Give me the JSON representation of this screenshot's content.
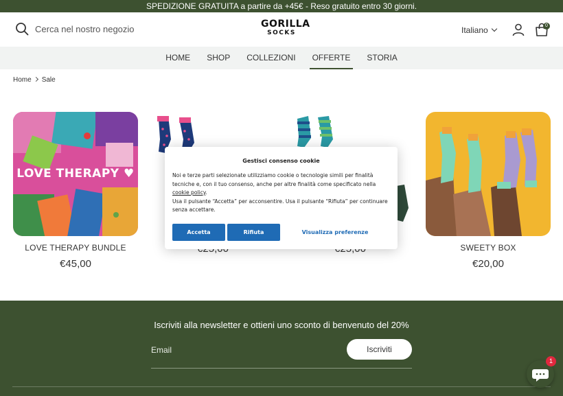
{
  "announcement": "SPEDIZIONE GRATUITA a partire da +45€ - Reso gratuito entro 30 giorni.",
  "header": {
    "search_placeholder": "Cerca nel nostro negozio",
    "logo_line1": "GORILLA",
    "logo_line2": "SOCKS",
    "language": "Italiano",
    "cart_count": "0"
  },
  "nav": [
    "HOME",
    "SHOP",
    "COLLEZIONI",
    "OFFERTE",
    "STORIA"
  ],
  "nav_active": "OFFERTE",
  "breadcrumb": {
    "home": "Home",
    "current": "Sale"
  },
  "products": [
    {
      "title": "LOVE THERAPY BUNDLE",
      "price": "€45,00",
      "image_text": "LOVE THERAPY ♥"
    },
    {
      "title": "",
      "price": "€25,00"
    },
    {
      "title": "",
      "price": "€25,00"
    },
    {
      "title": "SWEETY BOX",
      "price": "€20,00"
    }
  ],
  "cookie_banner": {
    "title": "Gestisci consenso cookie",
    "body_part1": "Noi e terze parti selezionate utilizziamo cookie o tecnologie simili per finalità tecniche e, con il tuo consenso, anche per altre finalità come specificato nella",
    "body_link": "cookie policy",
    "body_part2": "Usa il pulsante “Accetta” per acconsentire. Usa il pulsante “Rifiuta” per continuare senza accettare.",
    "accept": "Accetta",
    "reject": "Rifiuta",
    "preferences": "Visualizza preferenze"
  },
  "newsletter": {
    "text": "Iscriviti alla newsletter e ottieni uno sconto di benvenuto del 20%",
    "email_placeholder": "Email",
    "button": "Iscriviti"
  },
  "chat_badge": "1",
  "colors": {
    "brand_green": "#3d5130",
    "cookie_blue": "#1f6bb5",
    "badge_red": "#e0283e"
  }
}
